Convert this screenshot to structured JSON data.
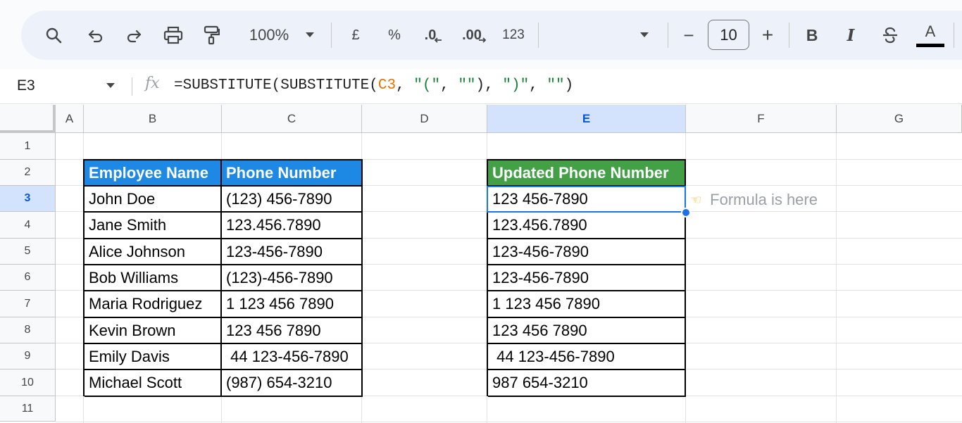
{
  "toolbar": {
    "zoom": "100%",
    "currency_label": "£",
    "percent_label": "%",
    "decrease_decimal_label": ".0",
    "increase_decimal_label": ".00",
    "number_format_label": "123",
    "font_size": "10",
    "bold_label": "B",
    "italic_label": "I",
    "text_color_label": "A",
    "minus_label": "−",
    "plus_label": "+"
  },
  "formula_bar": {
    "name_box": "E3",
    "fx_label": "fx",
    "formula_prefix": "=SUBSTITUTE(SUBSTITUTE(",
    "formula_ref": "C3",
    "formula_mid": ", ",
    "formula_str1": "\"(\"",
    "formula_sep1": ", ",
    "formula_str2": "\"\"",
    "formula_sep2": "), ",
    "formula_str3": "\")\"",
    "formula_sep3": ", ",
    "formula_str4": "\"\"",
    "formula_suffix": ")"
  },
  "columns": [
    "A",
    "B",
    "C",
    "D",
    "E",
    "F",
    "G"
  ],
  "rows": [
    "1",
    "2",
    "3",
    "4",
    "5",
    "6",
    "7",
    "8",
    "9",
    "10",
    "11"
  ],
  "table1": {
    "header_name": "Employee Name",
    "header_phone": "Phone Number",
    "rows": [
      {
        "name": "John Doe",
        "phone": "(123) 456-7890"
      },
      {
        "name": "Jane Smith",
        "phone": "123.456.7890"
      },
      {
        "name": "Alice Johnson",
        "phone": "123-456-7890"
      },
      {
        "name": "Bob Williams",
        "phone": "(123)-456-7890"
      },
      {
        "name": "Maria Rodriguez",
        "phone": "1 123 456 7890"
      },
      {
        "name": "Kevin Brown",
        "phone": "123 456 7890"
      },
      {
        "name": "Emily Davis",
        "phone": " 44 123-456-7890"
      },
      {
        "name": "Michael Scott",
        "phone": "(987) 654-3210"
      }
    ]
  },
  "table2": {
    "header": "Updated Phone Number",
    "rows": [
      "123 456-7890",
      "123.456.7890",
      "123-456-7890",
      "123-456-7890",
      "1 123 456 7890",
      "123 456 7890",
      " 44 123-456-7890",
      "987 654-3210"
    ]
  },
  "note": {
    "text": "Formula is here",
    "icon": "pointing-hand-icon"
  },
  "colors": {
    "header_blue": "#1e88e5",
    "header_green": "#43a047",
    "selection": "#1a73e8"
  }
}
